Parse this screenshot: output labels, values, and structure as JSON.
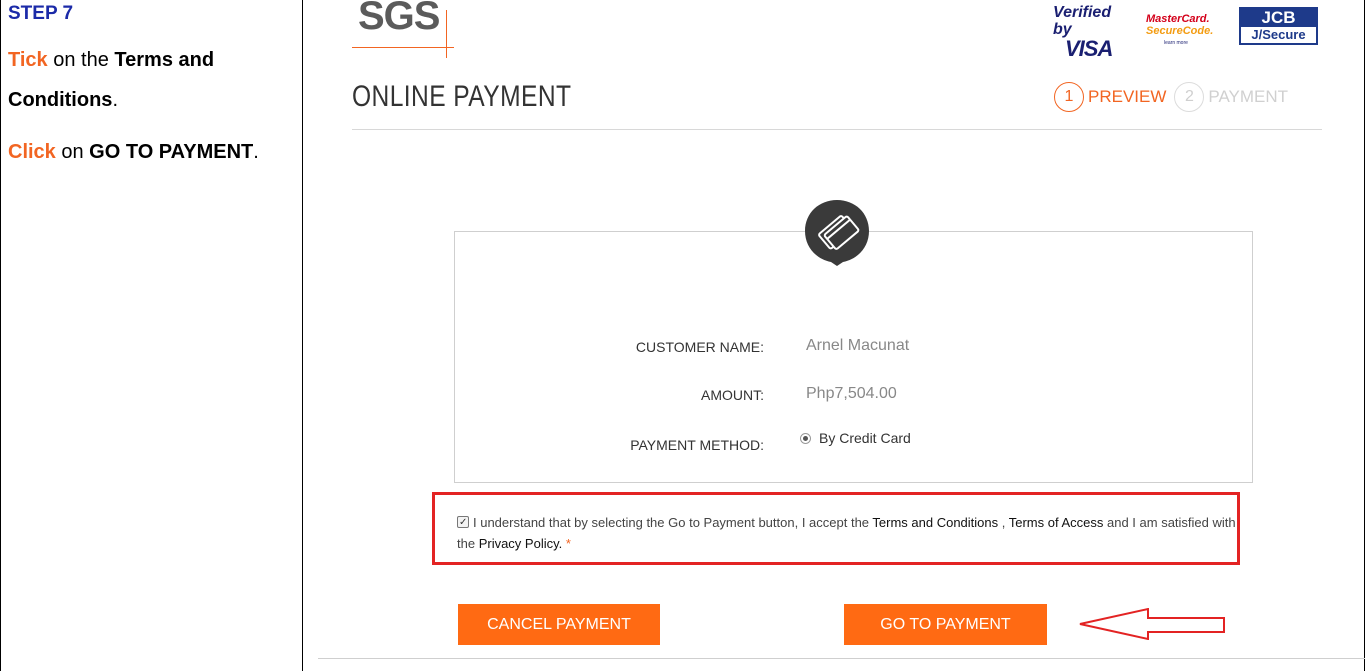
{
  "instructions": {
    "step_title": "STEP 7",
    "line1_action": "Tick",
    "line1_text": " on the ",
    "line1_bold": "Terms and Conditions",
    "line1_end": ".",
    "line2_action": "Click",
    "line2_text": " on ",
    "line2_bold": "GO TO PAYMENT",
    "line2_end": "."
  },
  "header": {
    "logo_text": "SGS",
    "verified_by": "Verified by",
    "visa": "VISA",
    "mastercard": "MasterCard.",
    "securecode": "SecureCode.",
    "learn_more": "learn more",
    "jcb": "JCB",
    "jsecure": "J/Secure"
  },
  "page": {
    "title": "ONLINE PAYMENT",
    "steps": [
      {
        "number": "1",
        "label": "PREVIEW",
        "active": true
      },
      {
        "number": "2",
        "label": "PAYMENT",
        "active": false
      }
    ]
  },
  "details": {
    "customer_name_label": "CUSTOMER NAME:",
    "customer_name_value": "Arnel Macunat",
    "amount_label": "AMOUNT:",
    "amount_value": "Php7,504.00",
    "payment_method_label": "PAYMENT METHOD:",
    "payment_method_value": "By Credit Card"
  },
  "terms": {
    "checked": true,
    "text_1": "I understand that by selecting the Go to Payment button, I accept the ",
    "link_terms": "Terms and Conditions",
    "text_2": " , ",
    "link_access": "Terms of Access",
    "text_3": " and I am satisfied with the ",
    "link_privacy": "Privacy Policy.",
    "required": " *"
  },
  "buttons": {
    "cancel": "CANCEL PAYMENT",
    "go": "GO TO PAYMENT"
  },
  "colors": {
    "accent": "#ff6a13",
    "highlight": "#e32323",
    "step_title": "#1b2aa8"
  }
}
